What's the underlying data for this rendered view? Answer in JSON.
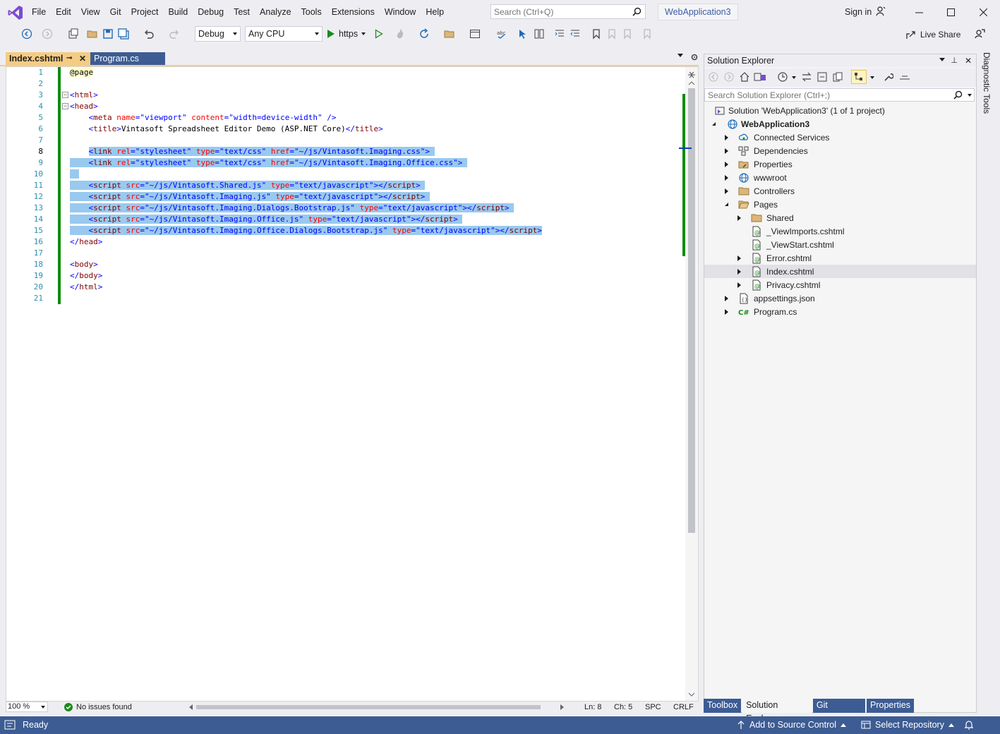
{
  "window": {
    "solution_name": "WebApplication3",
    "sign_in": "Sign in",
    "search_placeholder": "Search (Ctrl+Q)"
  },
  "menu": [
    "File",
    "Edit",
    "View",
    "Git",
    "Project",
    "Build",
    "Debug",
    "Test",
    "Analyze",
    "Tools",
    "Extensions",
    "Window",
    "Help"
  ],
  "toolbar": {
    "configuration": "Debug",
    "platform": "Any CPU",
    "run_target": "https",
    "live_share": "Live Share"
  },
  "tabs": [
    {
      "label": "Index.cshtml",
      "active": true
    },
    {
      "label": "Program.cs",
      "active": false
    }
  ],
  "editor": {
    "line_numbers": [
      "1",
      "2",
      "3",
      "4",
      "5",
      "6",
      "7",
      "8",
      "9",
      "10",
      "11",
      "12",
      "13",
      "14",
      "15",
      "16",
      "17",
      "18",
      "19",
      "20",
      "21"
    ],
    "status": {
      "zoom": "100 %",
      "issues": "No issues found",
      "line": "Ln: 8",
      "col": "Ch: 5",
      "spacing": "SPC",
      "eol": "CRLF"
    },
    "code": {
      "l1": "@page",
      "l6_text": "Vintasoft Spreadsheet Editor Demo (ASP.NET Core)",
      "css1": "\"~/js/Vintasoft.Imaging.css\"",
      "css2": "\"~/js/Vintasoft.Imaging.Office.css\"",
      "js1": "\"~/js/Vintasoft.Shared.js\"",
      "js2": "\"~/js/Vintasoft.Imaging.js\"",
      "js3": "\"~/js/Vintasoft.Imaging.Dialogs.Bootstrap.js\"",
      "js4": "\"~/js/Vintasoft.Imaging.Office.js\"",
      "js5": "\"~/js/Vintasoft.Imaging.Office.Dialogs.Bootstrap.js\""
    }
  },
  "solution_explorer": {
    "title": "Solution Explorer",
    "search_placeholder": "Search Solution Explorer (Ctrl+;)",
    "nodes": [
      {
        "label": "Solution 'WebApplication3' (1 of 1 project)",
        "icon": "solution-icon"
      },
      {
        "label": "WebApplication3",
        "icon": "web-project-icon"
      },
      {
        "label": "Connected Services",
        "icon": "connected-services-icon"
      },
      {
        "label": "Dependencies",
        "icon": "dependencies-icon"
      },
      {
        "label": "Properties",
        "icon": "properties-icon"
      },
      {
        "label": "wwwroot",
        "icon": "globe-icon"
      },
      {
        "label": "Controllers",
        "icon": "folder-icon"
      },
      {
        "label": "Pages",
        "icon": "folder-open-icon"
      },
      {
        "label": "Shared",
        "icon": "folder-icon"
      },
      {
        "label": "_ViewImports.cshtml",
        "icon": "razor-file-icon"
      },
      {
        "label": "_ViewStart.cshtml",
        "icon": "razor-file-icon"
      },
      {
        "label": "Error.cshtml",
        "icon": "razor-file-icon"
      },
      {
        "label": "Index.cshtml",
        "icon": "razor-file-icon"
      },
      {
        "label": "Privacy.cshtml",
        "icon": "razor-file-icon"
      },
      {
        "label": "appsettings.json",
        "icon": "json-file-icon"
      },
      {
        "label": "Program.cs",
        "icon": "csharp-file-icon"
      }
    ],
    "bottom_tabs": [
      "Toolbox",
      "Solution Explorer",
      "Git Changes",
      "Properties"
    ]
  },
  "diagnostic_tools": "Diagnostic Tools",
  "statusbar": {
    "ready": "Ready",
    "add_source_control": "Add to Source Control",
    "select_repository": "Select Repository"
  },
  "colors": {
    "accent": "#3d5c93",
    "active_tab": "#f5cc84",
    "selection": "#99c9ef",
    "change_bar": "#108b10"
  }
}
